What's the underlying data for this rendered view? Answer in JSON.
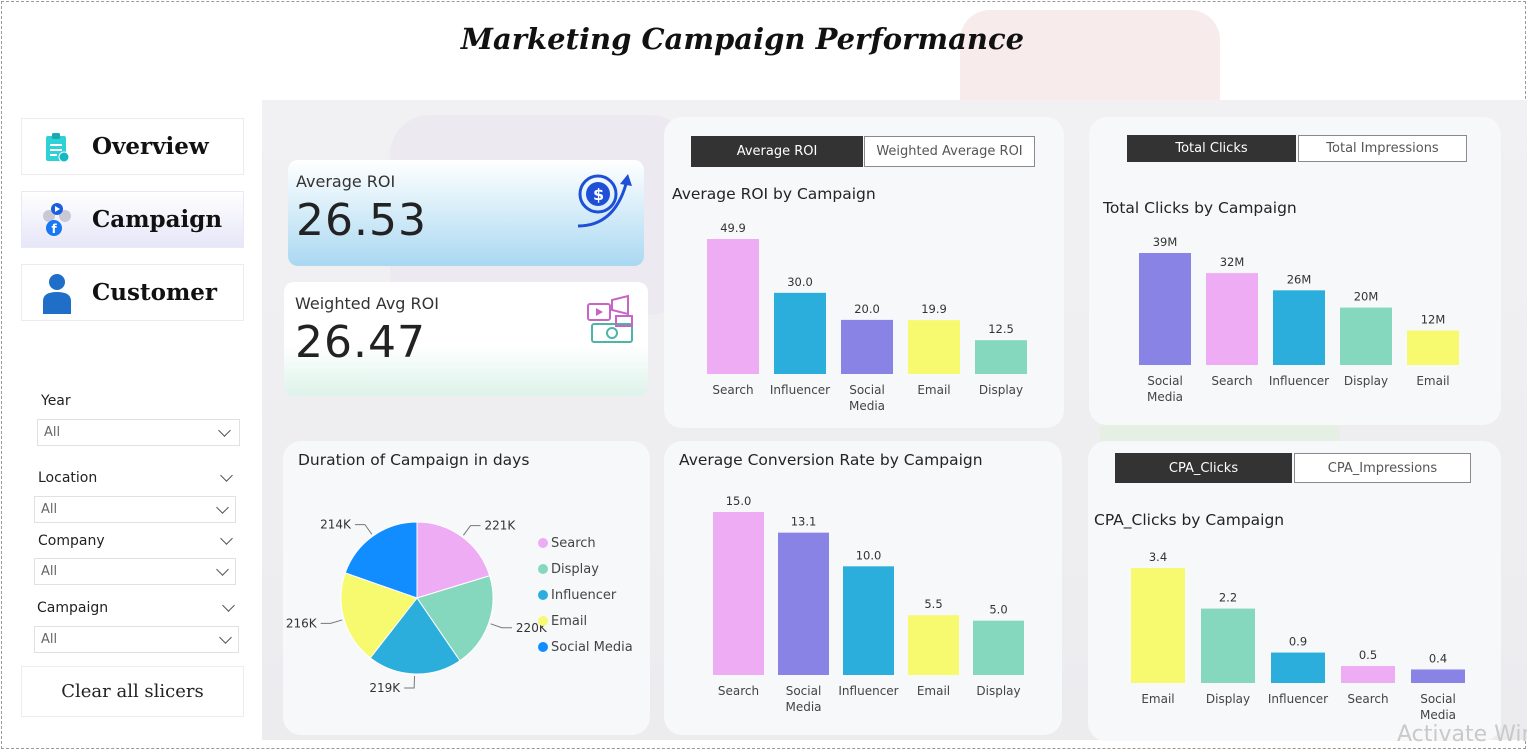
{
  "title": "Marketing Campaign Performance",
  "nav": [
    {
      "label": "Overview",
      "icon": "clipboard-icon"
    },
    {
      "label": "Campaign",
      "icon": "social-media-icon"
    },
    {
      "label": "Customer",
      "icon": "user-icon"
    }
  ],
  "slicers": {
    "year": {
      "label": "Year",
      "value": "All"
    },
    "location": {
      "label": "Location",
      "value": "All"
    },
    "company": {
      "label": "Company",
      "value": "All"
    },
    "campaign": {
      "label": "Campaign",
      "value": "All"
    },
    "clear_label": "Clear all slicers"
  },
  "kpis": {
    "avg_roi": {
      "label": "Average ROI",
      "value": "26.53"
    },
    "weighted_roi": {
      "label": "Weighted Avg ROI",
      "value": "26.47"
    }
  },
  "toggles": {
    "roi": {
      "on": "Average ROI",
      "off": "Weighted Average ROI"
    },
    "clicks": {
      "on": "Total Clicks",
      "off": "Total Impressions"
    },
    "cpa": {
      "on": "CPA_Clicks",
      "off": "CPA_Impressions"
    }
  },
  "colors": {
    "Search": "#edacf3",
    "Influencer": "#2baedc",
    "Social Media": "#8983e6",
    "Email": "#f7f96e",
    "Display": "#85d8bd",
    "SocialMediaPie": "#118dff"
  },
  "chart_data": [
    {
      "id": "roi",
      "type": "bar",
      "title": "Average ROI by Campaign",
      "categories": [
        "Search",
        "Influencer",
        "Social Media",
        "Email",
        "Display"
      ],
      "values": [
        49.9,
        30.0,
        20.0,
        19.9,
        12.5
      ],
      "labels": [
        "49.9",
        "30.0",
        "20.0",
        "19.9",
        "12.5"
      ],
      "ylim": [
        0,
        49.9
      ]
    },
    {
      "id": "clicks",
      "type": "bar",
      "title": "Total Clicks by Campaign",
      "categories": [
        "Social Media",
        "Search",
        "Influencer",
        "Display",
        "Email"
      ],
      "values": [
        39,
        32,
        26,
        20,
        12
      ],
      "labels": [
        "39M",
        "32M",
        "26M",
        "20M",
        "12M"
      ],
      "ylim": [
        0,
        39
      ]
    },
    {
      "id": "duration",
      "type": "pie",
      "title": "Duration of Campaign in days",
      "categories": [
        "Search",
        "Display",
        "Influencer",
        "Email",
        "Social Media"
      ],
      "values": [
        221,
        220,
        219,
        216,
        214
      ],
      "labels": [
        "221K",
        "220K",
        "219K",
        "216K",
        "214K"
      ],
      "legend": "right"
    },
    {
      "id": "conversion",
      "type": "bar",
      "title": "Average Conversion Rate by Campaign",
      "categories": [
        "Search",
        "Social Media",
        "Influencer",
        "Email",
        "Display"
      ],
      "values": [
        15.0,
        13.1,
        10.0,
        5.5,
        5.0
      ],
      "labels": [
        "15.0",
        "13.1",
        "10.0",
        "5.5",
        "5.0"
      ],
      "ylim": [
        0,
        15.0
      ]
    },
    {
      "id": "cpa",
      "type": "bar",
      "title": "CPA_Clicks by Campaign",
      "categories": [
        "Email",
        "Display",
        "Influencer",
        "Search",
        "Social Media"
      ],
      "values": [
        3.4,
        2.2,
        0.9,
        0.5,
        0.4
      ],
      "labels": [
        "3.4",
        "2.2",
        "0.9",
        "0.5",
        "0.4"
      ],
      "ylim": [
        0,
        3.4
      ]
    }
  ],
  "watermark": "Activate Windows"
}
